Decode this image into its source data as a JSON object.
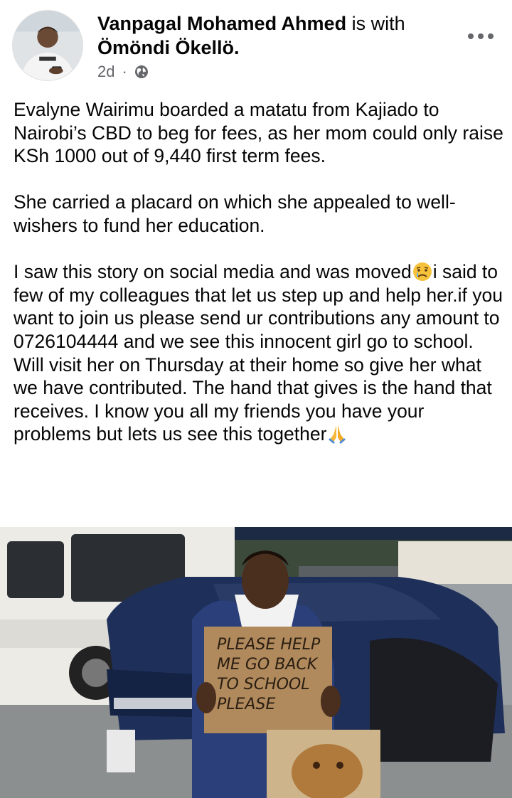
{
  "author": {
    "name": "Vanpagal Mohamed Ahmed",
    "connector": " is with",
    "tagged": "Ömöndi Ökellö."
  },
  "meta": {
    "time": "2d",
    "separator": "·",
    "privacy_icon": "globe-icon"
  },
  "post": {
    "paragraph1": "Evalyne Wairimu boarded a matatu from Kajiado to Nairobi’s CBD to beg for fees, as her mom could only raise KSh 1000 out of 9,440 first term fees.",
    "paragraph2": "She carried a placard on which she appealed to well-wishers to fund her education.",
    "paragraph3_a": "I saw this story on social media and was moved",
    "paragraph3_b": "i said to few of my colleagues that let us step up and help her.if you want to join us please send ur contributions any amount to 0726104444 and we see this innocent girl go to school. Will visit her on Thursday at their home so give her what we have contributed. The hand that gives is the hand that receives. I know you all my friends you have your problems but lets us see this together",
    "emoji1": "crying-face-emoji",
    "emoji2": "praying-hands-emoji"
  },
  "photo": {
    "placard_lines": [
      "PLEASE HELP",
      "ME GO BACK",
      "TO SCHOOL",
      "PLEASE"
    ]
  },
  "colors": {
    "text": "#050505",
    "secondary": "#65676b",
    "car": "#1e2f5a",
    "placard": "#b08a5c"
  }
}
